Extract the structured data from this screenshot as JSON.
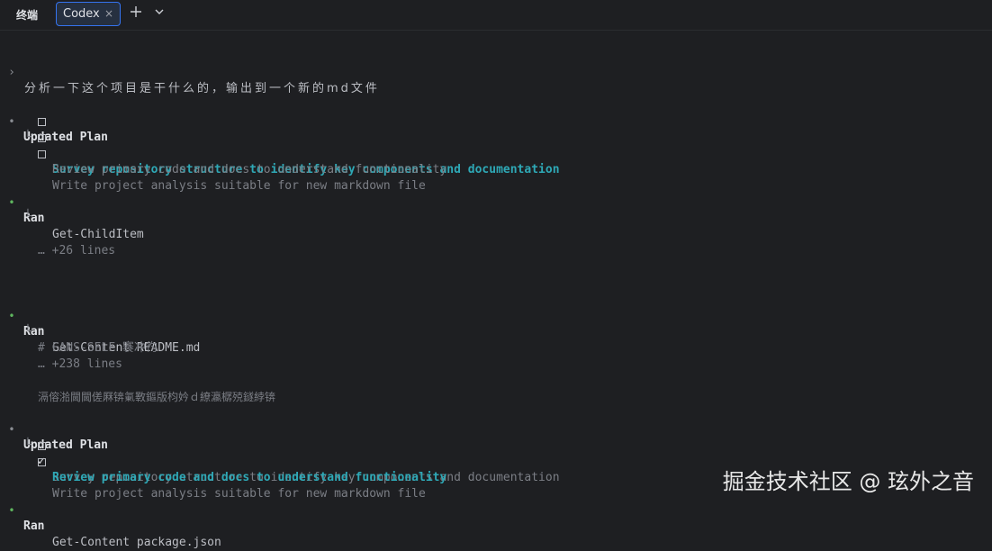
{
  "tabbar": {
    "title": "终端",
    "tab_label": "Codex",
    "tab_close": "×",
    "add_icon": "plus-icon",
    "dropdown_icon": "chevron-down-icon"
  },
  "prompt": {
    "marker": "›",
    "text": "分析一下这个项目是干什么的，输出到一个新的md文件"
  },
  "plan1": {
    "bullet": "•",
    "title": "Updated Plan",
    "elbow": "└",
    "items": [
      "Survey repository structure to identify key components and documentation",
      "Review primary code and docs to understand functionality",
      "Write project analysis suitable for new markdown file"
    ]
  },
  "ran1": {
    "bullet": "•",
    "verb": "Ran",
    "command": "Get-ChildItem",
    "elbow": "└",
    "more": "… +26 lines"
  },
  "ran2": {
    "bullet": "•",
    "verb": "Ran",
    "command": "Get-Content README.md",
    "elbow": "└",
    "first_line": "# FANS-SELF 褰冲彴",
    "more": "… +238 lines",
    "garbled": "滆傛湁閫閫傞厤锛氭斁鏂版枃妗ｄ繚瀛樼殑鐩綍锛"
  },
  "plan2": {
    "bullet": "•",
    "title": "Updated Plan",
    "elbow": "└",
    "done_mark": "✓",
    "items": [
      "Survey repository structure to identify key components and documentation",
      "Review primary code and docs to understand functionality",
      "Write project analysis suitable for new markdown file"
    ]
  },
  "ran3": {
    "bullet": "•",
    "verb": "Ran",
    "command": "Get-Content package.json"
  },
  "watermark": "掘金技术社区 @ 玹外之音",
  "colors": {
    "background": "#1e1f22",
    "active_step": "#2ea8b6",
    "success_bullet": "#5fb65f",
    "tab_border": "#3574f0"
  }
}
